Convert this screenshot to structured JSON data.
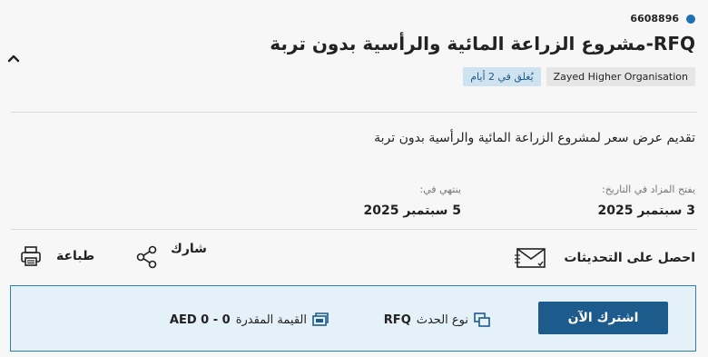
{
  "header": {
    "reference_number": "6608896",
    "title": "RFQ-مشروع الزراعة المائية والرأسية بدون تربة",
    "organisation_tag": "Zayed Higher Organisation",
    "closing_tag": "يُغلق في 2 أيام"
  },
  "description": "تقديم عرض سعر لمشروع الزراعة المائية والرأسية بدون تربة",
  "dates": {
    "opens_label": "يفتح المزاد في التاريخ:",
    "opens_value": "3 سبتمبر 2025",
    "ends_label": "ينتهي في:",
    "ends_value": "5 سبتمبر 2025"
  },
  "actions": {
    "updates_label": "احصل على التحديثات",
    "share_label": "شارك",
    "print_label": "طباعة"
  },
  "info": {
    "subscribe_label": "اشترك الآن",
    "event_type_label": "نوع الحدث",
    "event_type_value": "RFQ",
    "estimated_value_label": "القيمة المقدرة",
    "estimated_value_value": "AED 0 - 0"
  },
  "colors": {
    "accent": "#1d5b8c",
    "info_bg": "#e5f1f8",
    "tag_close_bg": "#cfe2ef",
    "dot": "#1f6fb2"
  },
  "icons": {
    "collapse": "chevron-up-icon",
    "updates": "envelope-icon",
    "share": "share-icon",
    "print": "printer-icon",
    "event_type": "copy-icon",
    "estimated_value": "money-icon"
  }
}
